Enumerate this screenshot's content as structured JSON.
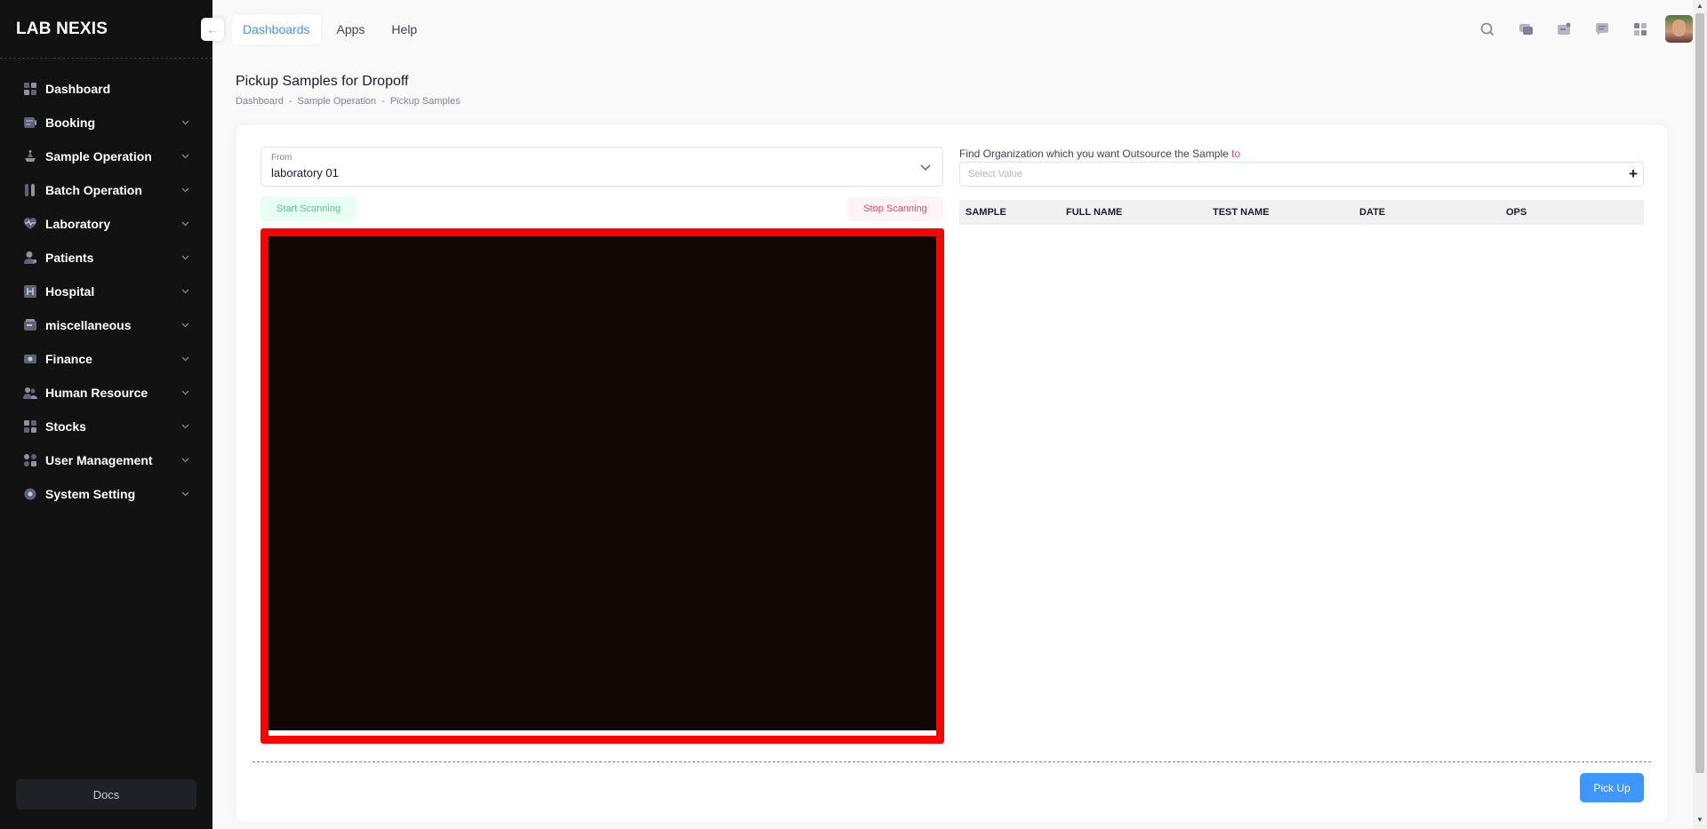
{
  "brand": {
    "name": "LAB NEXIS"
  },
  "sidebar": {
    "items": [
      {
        "label": "Dashboard",
        "icon": "dashboard-icon",
        "has_submenu": false
      },
      {
        "label": "Booking",
        "icon": "booking-icon",
        "has_submenu": true
      },
      {
        "label": "Sample Operation",
        "icon": "sample-operation-icon",
        "has_submenu": true
      },
      {
        "label": "Batch Operation",
        "icon": "batch-operation-icon",
        "has_submenu": true
      },
      {
        "label": "Laboratory",
        "icon": "laboratory-icon",
        "has_submenu": true
      },
      {
        "label": "Patients",
        "icon": "patients-icon",
        "has_submenu": true
      },
      {
        "label": "Hospital",
        "icon": "hospital-icon",
        "has_submenu": true
      },
      {
        "label": "miscellaneous",
        "icon": "miscellaneous-icon",
        "has_submenu": true
      },
      {
        "label": "Finance",
        "icon": "finance-icon",
        "has_submenu": true
      },
      {
        "label": "Human Resource",
        "icon": "human-resource-icon",
        "has_submenu": true
      },
      {
        "label": "Stocks",
        "icon": "stocks-icon",
        "has_submenu": true
      },
      {
        "label": "User Management",
        "icon": "user-management-icon",
        "has_submenu": true
      },
      {
        "label": "System Setting",
        "icon": "system-setting-icon",
        "has_submenu": true
      }
    ],
    "docs_label": "Docs"
  },
  "header": {
    "tabs": [
      {
        "label": "Dashboards",
        "active": true
      },
      {
        "label": "Apps",
        "active": false
      },
      {
        "label": "Help",
        "active": false
      }
    ],
    "toolbar_icons": [
      "search-icon",
      "chat-icon",
      "notification-icon",
      "message-icon",
      "apps-grid-icon"
    ]
  },
  "page": {
    "title": "Pickup Samples for Dropoff",
    "breadcrumb": [
      "Dashboard",
      "-",
      "Sample Operation",
      "-",
      "Pickup Samples"
    ]
  },
  "form": {
    "from_label": "From",
    "from_value": "laboratory 01",
    "start_scanning": "Start Scanning",
    "stop_scanning": "Stop Scanning",
    "org_label": "Find Organization which you want Outsource the Sample",
    "org_label_required": "to",
    "org_placeholder": "Select Value",
    "pickup_button": "Pick Up"
  },
  "table": {
    "columns": [
      "SAMPLE",
      "FULL NAME",
      "TEST NAME",
      "DATE",
      "OPS"
    ],
    "rows": []
  },
  "colors": {
    "sidebar_bg": "#121212",
    "primary": "#3e97ff",
    "success": "#50cd89",
    "danger": "#f1416c",
    "scanner_border": "#ff0000"
  }
}
